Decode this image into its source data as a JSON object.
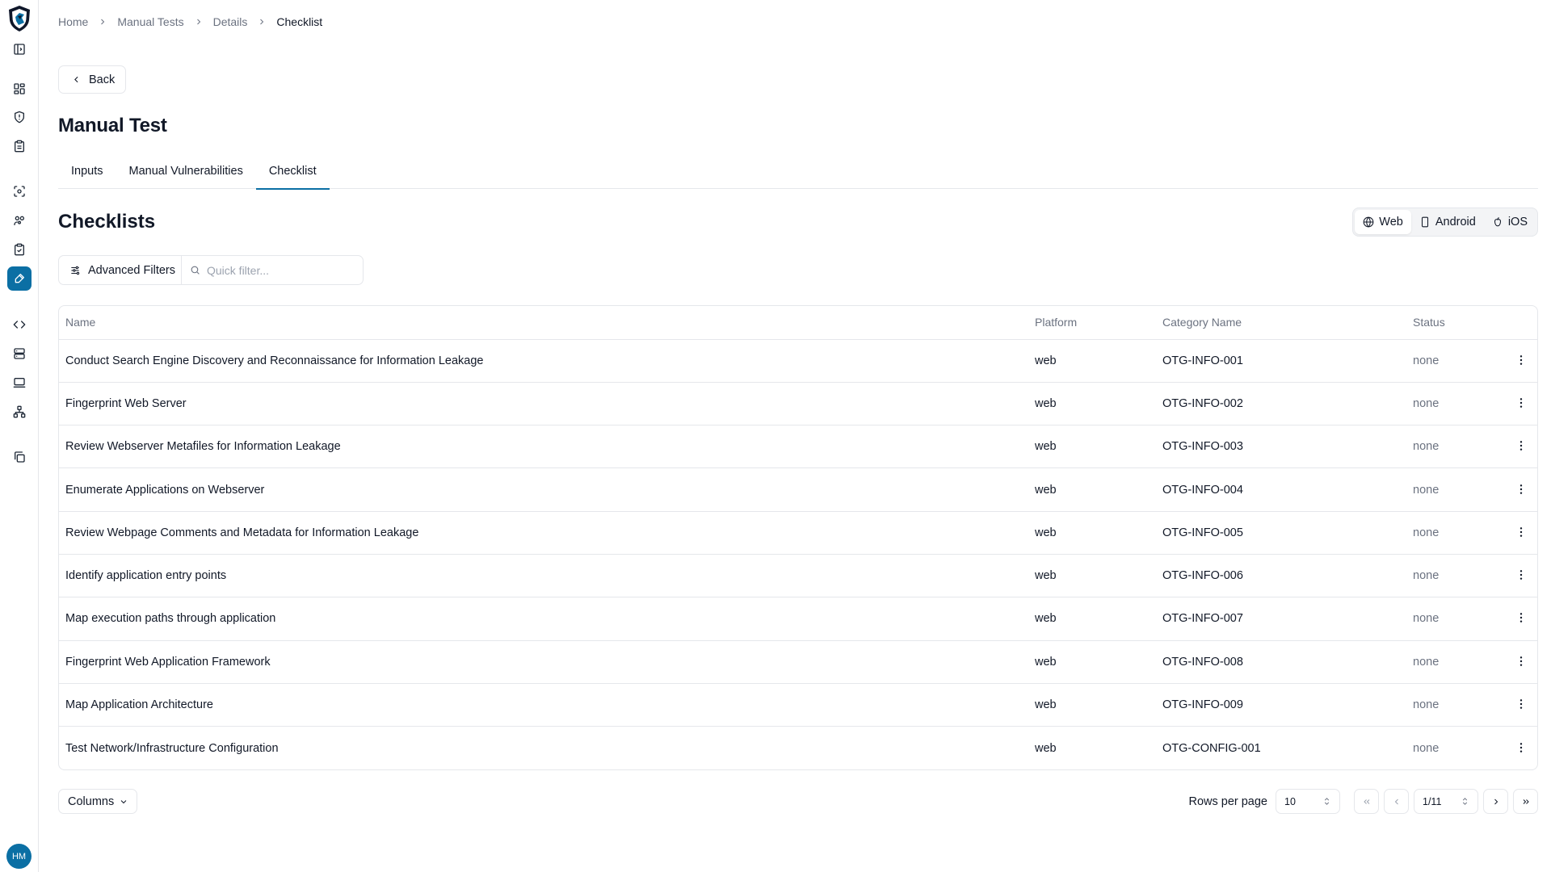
{
  "breadcrumb": [
    "Home",
    "Manual Tests",
    "Details",
    "Checklist"
  ],
  "back_label": "Back",
  "page_title": "Manual Test",
  "tabs": [
    {
      "label": "Inputs",
      "active": false
    },
    {
      "label": "Manual Vulnerabilities",
      "active": false
    },
    {
      "label": "Checklist",
      "active": true
    }
  ],
  "section_title": "Checklists",
  "platforms": [
    {
      "label": "Web",
      "icon": "globe-icon",
      "active": true
    },
    {
      "label": "Android",
      "icon": "phone-icon",
      "active": false
    },
    {
      "label": "iOS",
      "icon": "apple-icon",
      "active": false
    }
  ],
  "filters": {
    "advanced_label": "Advanced Filters",
    "quick_placeholder": "Quick filter..."
  },
  "table": {
    "columns": [
      "Name",
      "Platform",
      "Category Name",
      "Status"
    ],
    "rows": [
      {
        "name": "Conduct Search Engine Discovery and Reconnaissance for Information Leakage",
        "platform": "web",
        "category": "OTG-INFO-001",
        "status": "none"
      },
      {
        "name": "Fingerprint Web Server",
        "platform": "web",
        "category": "OTG-INFO-002",
        "status": "none"
      },
      {
        "name": "Review Webserver Metafiles for Information Leakage",
        "platform": "web",
        "category": "OTG-INFO-003",
        "status": "none"
      },
      {
        "name": "Enumerate Applications on Webserver",
        "platform": "web",
        "category": "OTG-INFO-004",
        "status": "none"
      },
      {
        "name": "Review Webpage Comments and Metadata for Information Leakage",
        "platform": "web",
        "category": "OTG-INFO-005",
        "status": "none"
      },
      {
        "name": "Identify application entry points",
        "platform": "web",
        "category": "OTG-INFO-006",
        "status": "none"
      },
      {
        "name": "Map execution paths through application",
        "platform": "web",
        "category": "OTG-INFO-007",
        "status": "none"
      },
      {
        "name": "Fingerprint Web Application Framework",
        "platform": "web",
        "category": "OTG-INFO-008",
        "status": "none"
      },
      {
        "name": "Map Application Architecture",
        "platform": "web",
        "category": "OTG-INFO-009",
        "status": "none"
      },
      {
        "name": "Test Network/Infrastructure Configuration",
        "platform": "web",
        "category": "OTG-CONFIG-001",
        "status": "none"
      }
    ]
  },
  "footer": {
    "columns_label": "Columns",
    "rows_per_page_label": "Rows per page",
    "rows_per_page_value": "10",
    "page_value": "1/11"
  },
  "user": {
    "initials": "HM"
  },
  "colors": {
    "accent": "#0b6fa4",
    "border": "#e5e7eb",
    "muted": "#6b7280"
  }
}
